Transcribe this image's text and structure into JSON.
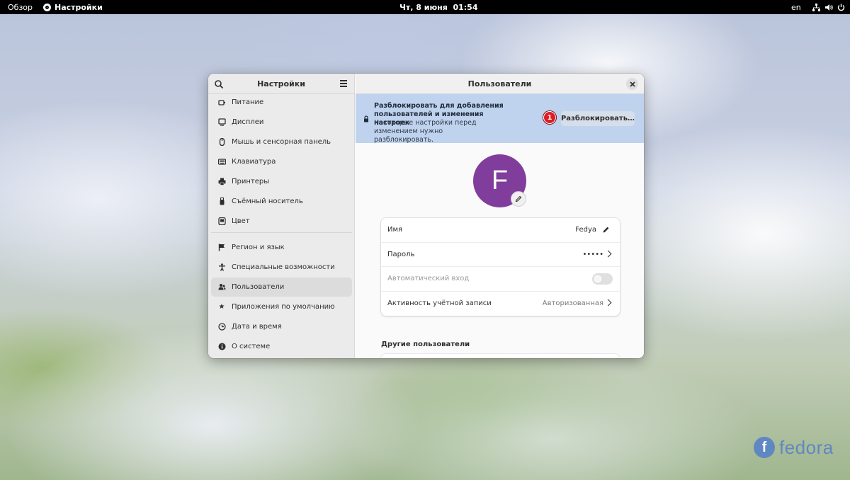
{
  "topbar": {
    "overview_label": "Обзор",
    "app_label": "Настройки",
    "clock": "Чт, 8 июня  01:54",
    "lang": "en"
  },
  "sidebar": {
    "title": "Настройки",
    "items": [
      {
        "label": "Питание",
        "icon": "power-plug-icon"
      },
      {
        "label": "Дисплеи",
        "icon": "display-icon"
      },
      {
        "label": "Мышь и сенсорная панель",
        "icon": "mouse-icon"
      },
      {
        "label": "Клавиатура",
        "icon": "keyboard-icon"
      },
      {
        "label": "Принтеры",
        "icon": "printer-icon"
      },
      {
        "label": "Съёмный носитель",
        "icon": "usb-drive-icon"
      },
      {
        "label": "Цвет",
        "icon": "color-icon"
      },
      {
        "label": "Регион и язык",
        "icon": "flag-icon"
      },
      {
        "label": "Специальные возможности",
        "icon": "accessibility-icon"
      },
      {
        "label": "Пользователи",
        "icon": "users-icon",
        "active": true
      },
      {
        "label": "Приложения по умолчанию",
        "icon": "star-icon"
      },
      {
        "label": "Дата и время",
        "icon": "clock-icon"
      },
      {
        "label": "О системе",
        "icon": "info-icon"
      }
    ]
  },
  "main": {
    "title": "Пользователи",
    "banner": {
      "title": "Разблокировать для добавления пользователей и изменения настроек",
      "subtitle": "Некоторые настройки перед изменением нужно разблокировать.",
      "badge": "1",
      "unlock_label": "Разблокировать…"
    },
    "avatar_letter": "F",
    "avatar_color": "#813d9c",
    "rows": {
      "name_label": "Имя",
      "name_value": "Fedya",
      "password_label": "Пароль",
      "password_value": "•••••",
      "autologin_label": "Автоматический вход",
      "activity_label": "Активность учётной записи",
      "activity_value": "Авторизованная"
    },
    "others_title": "Другие пользователи"
  },
  "wallpaper": {
    "logo_letter": "f",
    "logo_text": "fedora"
  }
}
